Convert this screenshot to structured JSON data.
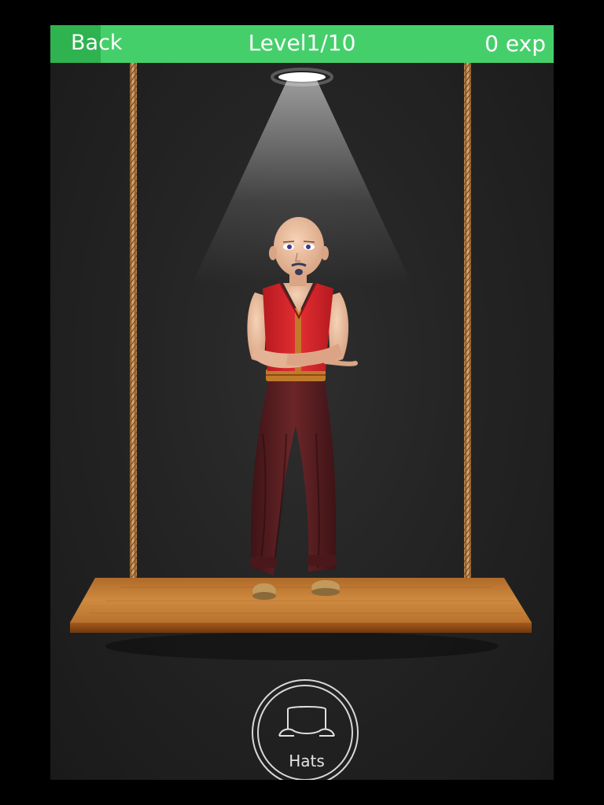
{
  "header": {
    "back_label": "Back",
    "level_label": "Level1/10",
    "exp_label": "0 exp"
  },
  "bottom": {
    "hats_label": "Hats",
    "hats_icon": "hat-icon"
  },
  "colors": {
    "topbar": "#45cf6b",
    "back_button": "#2fb250",
    "background": "#262626",
    "platform": "#c47a32",
    "rope": "#d6a062",
    "vest": "#d9262b",
    "pants": "#5a1f22"
  }
}
